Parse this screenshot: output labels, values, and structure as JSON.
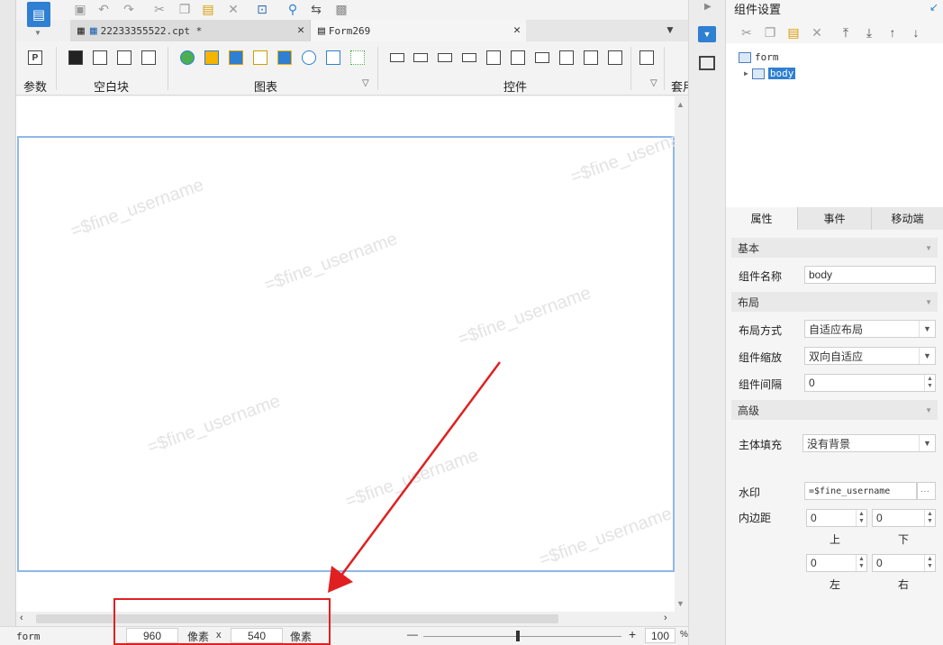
{
  "tabs": [
    {
      "label": "22233355522.cpt *"
    },
    {
      "label": "Form269"
    }
  ],
  "ribbon": {
    "groups": {
      "params": "参数",
      "blank": "空白块",
      "chart": "图表",
      "control": "控件",
      "apply": "套用"
    }
  },
  "watermark": "=$fine_username",
  "status": {
    "form_label": "form",
    "width": "960",
    "height": "540",
    "unit": "像素",
    "times": "x",
    "zoom": "100",
    "percent": "%",
    "minus": "—",
    "plus": "+"
  },
  "panel": {
    "title": "组件设置",
    "tree": {
      "root": "form",
      "child": "body"
    },
    "tabs": [
      "属性",
      "事件",
      "移动端"
    ],
    "sections": {
      "basic": "基本",
      "layout": "布局",
      "advanced": "高级"
    },
    "fields": {
      "name_label": "组件名称",
      "name_value": "body",
      "layout_mode_label": "布局方式",
      "layout_mode_value": "自适应布局",
      "scale_label": "组件缩放",
      "scale_value": "双向自适应",
      "spacing_label": "组件间隔",
      "spacing_value": "0",
      "fill_label": "主体填充",
      "fill_value": "没有背景",
      "watermark_label": "水印",
      "watermark_value": "=$fine_username",
      "padding_label": "内边距",
      "pad_top": "0",
      "pad_bottom": "0",
      "pad_left": "0",
      "pad_right": "0",
      "top": "上",
      "bottom": "下",
      "left": "左",
      "right": "右"
    }
  },
  "colors": {
    "accent": "#2f7fd3",
    "highlight": "#e02020"
  }
}
